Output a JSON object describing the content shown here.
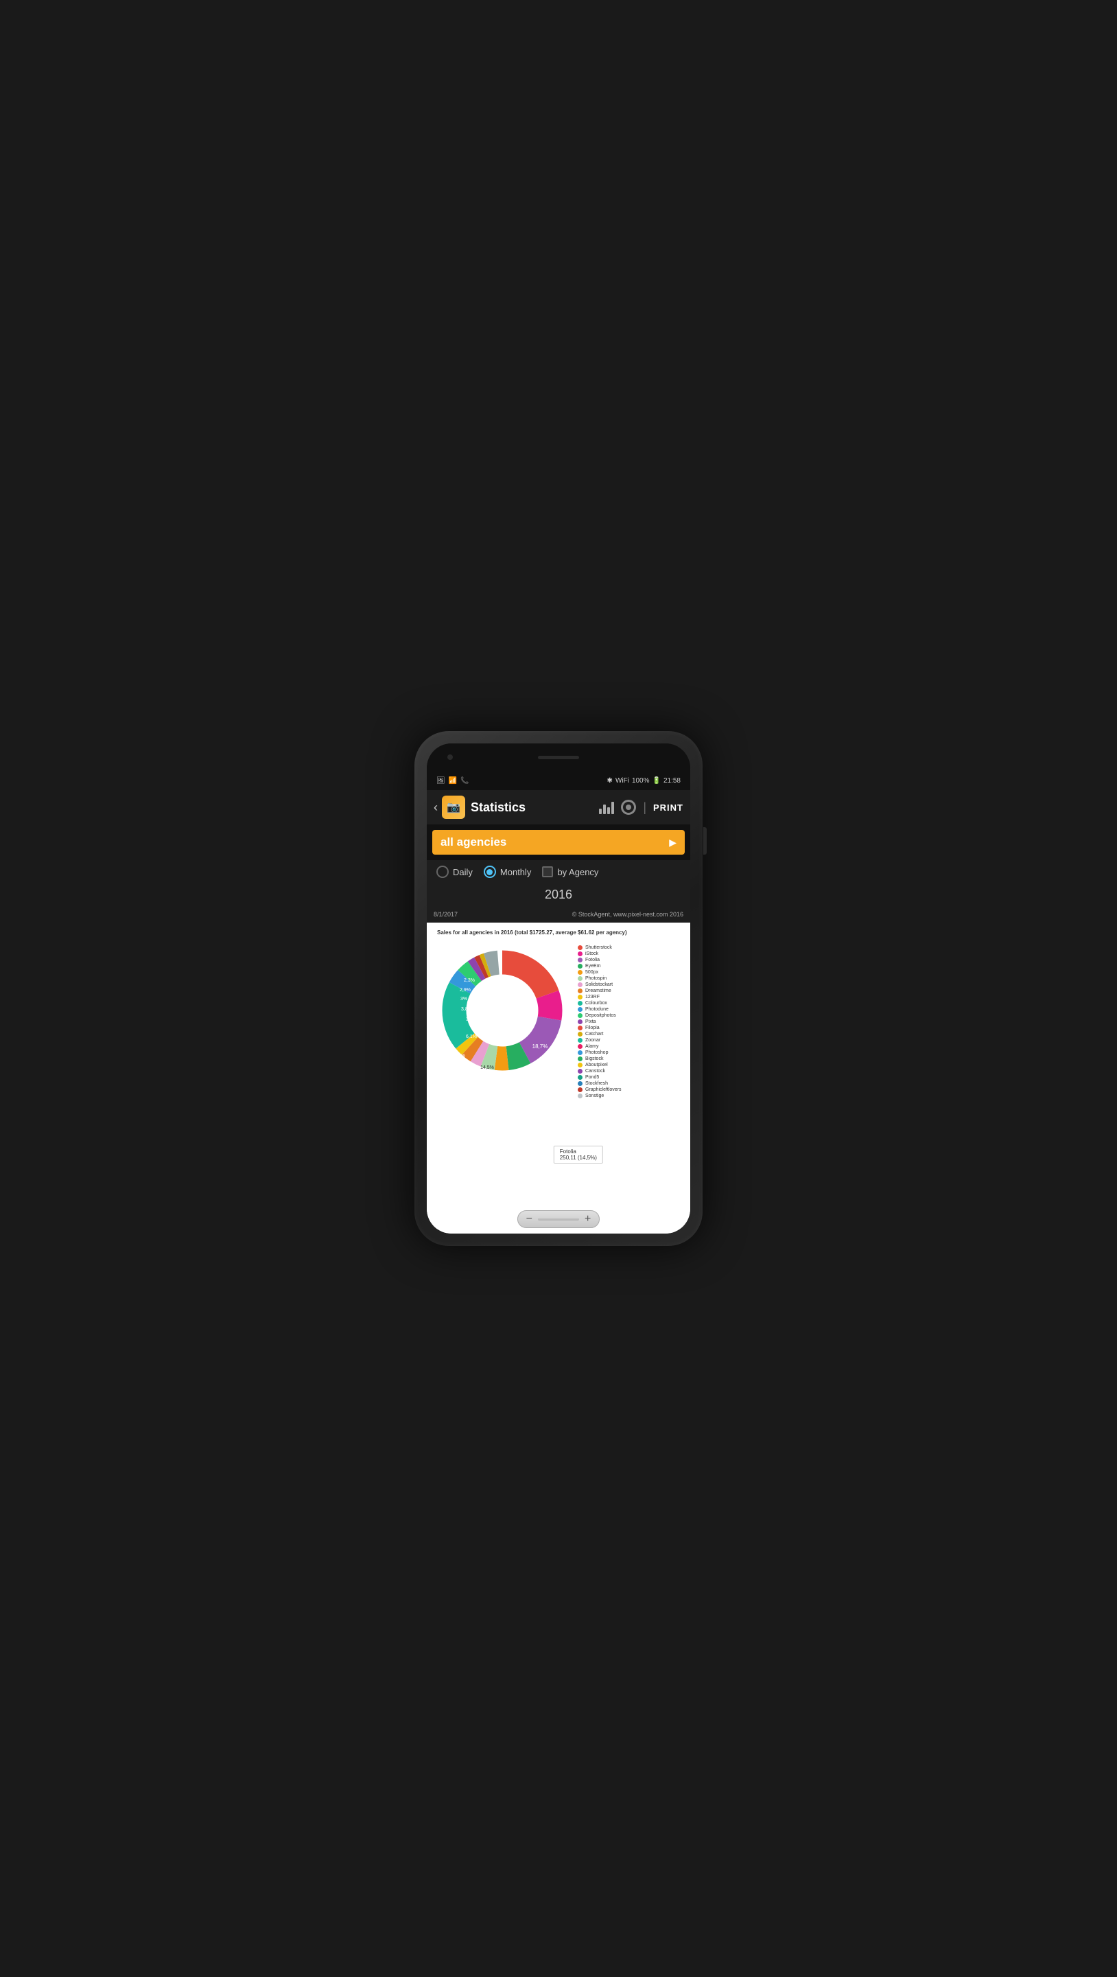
{
  "status": {
    "time": "21:58",
    "battery": "100%",
    "icons_left": [
      "📷",
      "📶",
      "📞"
    ]
  },
  "app_bar": {
    "title": "Statistics",
    "icon": "📷",
    "print_label": "PRINT"
  },
  "agency": {
    "label": "all agencies"
  },
  "filters": {
    "daily_label": "Daily",
    "monthly_label": "Monthly",
    "by_agency_label": "by Agency",
    "monthly_selected": true
  },
  "year": {
    "value": "2016"
  },
  "chart": {
    "date_label": "8/1/2017",
    "copyright": "© StockAgent, www.pixel-nest.com 2016",
    "title": "Sales for all agencies in 2016 (total $1725.27, average $61.62 per agency)",
    "tooltip": {
      "name": "Fotolia",
      "value": "250,11 (14,5%)"
    },
    "segments": [
      {
        "label": "Shutterstock",
        "color": "#e74c3c",
        "value": 19.6
      },
      {
        "label": "iStock",
        "color": "#e91e8c",
        "value": 8.1
      },
      {
        "label": "Fotolia",
        "color": "#9b59b6",
        "value": 14.5
      },
      {
        "label": "EyeEm",
        "color": "#27ae60",
        "value": 6.1
      },
      {
        "label": "500px",
        "color": "#f39c12",
        "value": 3.8
      },
      {
        "label": "Photospin",
        "color": "#a8d8a8",
        "value": 3.8
      },
      {
        "label": "Solidstockart",
        "color": "#e8a0d0",
        "value": 3.0
      },
      {
        "label": "Dreamstime",
        "color": "#e67e22",
        "value": 2.9
      },
      {
        "label": "123RF",
        "color": "#f1c40f",
        "value": 2.3
      },
      {
        "label": "Colourbox",
        "color": "#1abc9c",
        "value": 18.7
      },
      {
        "label": "Photodune",
        "color": "#3498db",
        "value": 4.0
      },
      {
        "label": "Depositphotos",
        "color": "#2ecc71",
        "value": 3.5
      },
      {
        "label": "Pixta",
        "color": "#9b59b6",
        "value": 2.0
      },
      {
        "label": "Filopia",
        "color": "#e74c3c",
        "value": 1.5
      },
      {
        "label": "Catchart",
        "color": "#f39c12",
        "value": 1.2
      },
      {
        "label": "Zoonar",
        "color": "#1abc9c",
        "value": 1.0
      },
      {
        "label": "Alamy",
        "color": "#e91e63",
        "value": 0.8
      },
      {
        "label": "Photoshop",
        "color": "#3498db",
        "value": 0.7
      },
      {
        "label": "Bigstock",
        "color": "#27ae60",
        "value": 0.6
      },
      {
        "label": "Aboutpixel",
        "color": "#f1c40f",
        "value": 0.5
      },
      {
        "label": "Canstock",
        "color": "#8e44ad",
        "value": 0.4
      },
      {
        "label": "Pond5",
        "color": "#16a085",
        "value": 0.3
      },
      {
        "label": "Stockfresh",
        "color": "#2980b9",
        "value": 0.3
      },
      {
        "label": "Graphicleftlovers",
        "color": "#c0392b",
        "value": 0.2
      },
      {
        "label": "Sonstige",
        "color": "#bdc3c7",
        "value": 0.2
      }
    ]
  },
  "zoom": {
    "minus_label": "−",
    "plus_label": "+"
  }
}
